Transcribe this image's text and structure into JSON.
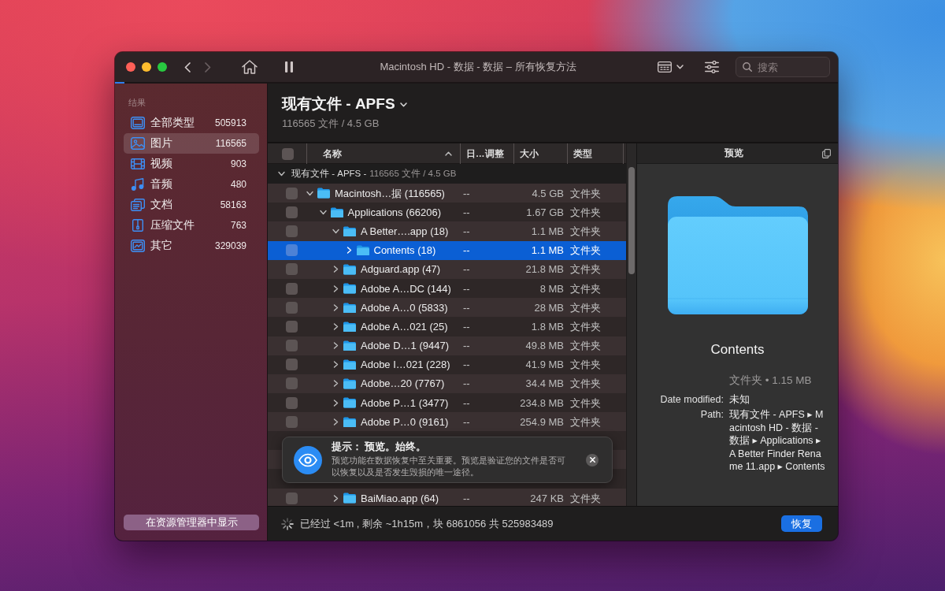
{
  "window": {
    "title": "Macintosh HD - 数据 - 数据 – 所有恢复方法"
  },
  "toolbar": {
    "nav_buttons": [
      {
        "kind": "back",
        "disabled": false
      },
      {
        "kind": "forward",
        "disabled": true
      }
    ],
    "search": {
      "placeholder": "搜索"
    }
  },
  "scan_progress": {
    "level": 0.013
  },
  "sidebar": {
    "section_title": "结果",
    "items": [
      {
        "kind": "all",
        "label": "全部类型",
        "count": "505913",
        "selected": false
      },
      {
        "kind": "image",
        "label": "图片",
        "count": "116565",
        "selected": true
      },
      {
        "kind": "video",
        "label": "视频",
        "count": "903",
        "selected": false
      },
      {
        "kind": "audio",
        "label": "音频",
        "count": "480",
        "selected": false
      },
      {
        "kind": "document",
        "label": "文档",
        "count": "58163",
        "selected": false
      },
      {
        "kind": "archive",
        "label": "压缩文件",
        "count": "763",
        "selected": false
      },
      {
        "kind": "other",
        "label": "其它",
        "count": "329039",
        "selected": false
      }
    ],
    "reveal_button": "在资源管理器中显示"
  },
  "header": {
    "title": "现有文件 - APFS",
    "subtitle": "116565 文件 / 4.5 GB"
  },
  "table": {
    "select_all": {
      "checked": false
    },
    "sort_ascending": true,
    "columns": [
      {
        "label": "名称",
        "sorted": true
      },
      {
        "label": "日…调整",
        "sorted": false
      },
      {
        "label": "大小",
        "sorted": false
      },
      {
        "label": "类型",
        "sorted": false
      }
    ],
    "group": {
      "title": "现有文件 - APFS -",
      "summary": "116565 文件 / 4.5 GB",
      "expanded": true
    },
    "rows": [
      {
        "name": "Macintosh…据 (116565)",
        "date": "--",
        "size": "4.5 GB",
        "type": "文件夹",
        "checked": false,
        "expanded": true,
        "selected": false,
        "children": [
          {
            "name": "Applications (66206)",
            "date": "--",
            "size": "1.67 GB",
            "type": "文件夹",
            "checked": false,
            "expanded": true,
            "selected": false,
            "children": [
              {
                "name": "A Better….app (18)",
                "date": "--",
                "size": "1.1 MB",
                "type": "文件夹",
                "checked": false,
                "expanded": true,
                "selected": false,
                "children": [
                  {
                    "name": "Contents (18)",
                    "date": "--",
                    "size": "1.1 MB",
                    "type": "文件夹",
                    "checked": false,
                    "expanded": false,
                    "selected": true
                  }
                ]
              },
              {
                "name": "Adguard.app (47)",
                "date": "--",
                "size": "21.8 MB",
                "type": "文件夹",
                "checked": false,
                "expanded": false,
                "selected": false
              },
              {
                "name": "Adobe A…DC (144)",
                "date": "--",
                "size": "8 MB",
                "type": "文件夹",
                "checked": false,
                "expanded": false,
                "selected": false
              },
              {
                "name": "Adobe A…0 (5833)",
                "date": "--",
                "size": "28 MB",
                "type": "文件夹",
                "checked": false,
                "expanded": false,
                "selected": false
              },
              {
                "name": "Adobe A…021 (25)",
                "date": "--",
                "size": "1.8 MB",
                "type": "文件夹",
                "checked": false,
                "expanded": false,
                "selected": false
              },
              {
                "name": "Adobe D…1 (9447)",
                "date": "--",
                "size": "49.8 MB",
                "type": "文件夹",
                "checked": false,
                "expanded": false,
                "selected": false
              },
              {
                "name": "Adobe I…021 (228)",
                "date": "--",
                "size": "41.9 MB",
                "type": "文件夹",
                "checked": false,
                "expanded": false,
                "selected": false
              },
              {
                "name": "Adobe…20 (7767)",
                "date": "--",
                "size": "34.4 MB",
                "type": "文件夹",
                "checked": false,
                "expanded": false,
                "selected": false
              },
              {
                "name": "Adobe P…1 (3477)",
                "date": "--",
                "size": "234.8 MB",
                "type": "文件夹",
                "checked": false,
                "expanded": false,
                "selected": false
              },
              {
                "name": "Adobe P…0 (9161)",
                "date": "--",
                "size": "254.9 MB",
                "type": "文件夹",
                "checked": false,
                "expanded": false,
                "selected": false
              },
              {
                "name": "BaiMiao.app (64)",
                "date": "--",
                "size": "247 KB",
                "type": "文件夹",
                "checked": false,
                "expanded": false,
                "selected": false
              }
            ]
          }
        ]
      }
    ]
  },
  "tip": {
    "title": "提示： 预览。始终。",
    "text": "预览功能在数据恢复中至关重要。预览是验证您的文件是否可以恢复以及是否发生毁损的唯一途径。"
  },
  "preview": {
    "title": "预览",
    "name": "Contents",
    "summary": "文件夹 • 1.15 MB",
    "fields": [
      {
        "label": "Date modified:",
        "value": "未知"
      },
      {
        "label": "Path:",
        "value": "现有文件 - APFS ▸ Macintosh HD - 数据 - 数据 ▸ Applications ▸ A Better Finder Rename 11.app ▸ Contents"
      }
    ]
  },
  "status_bar": {
    "text": "已经过 <1m , 剩余 ~1h15m，块 6861056 共 525983489",
    "button": "恢复"
  }
}
